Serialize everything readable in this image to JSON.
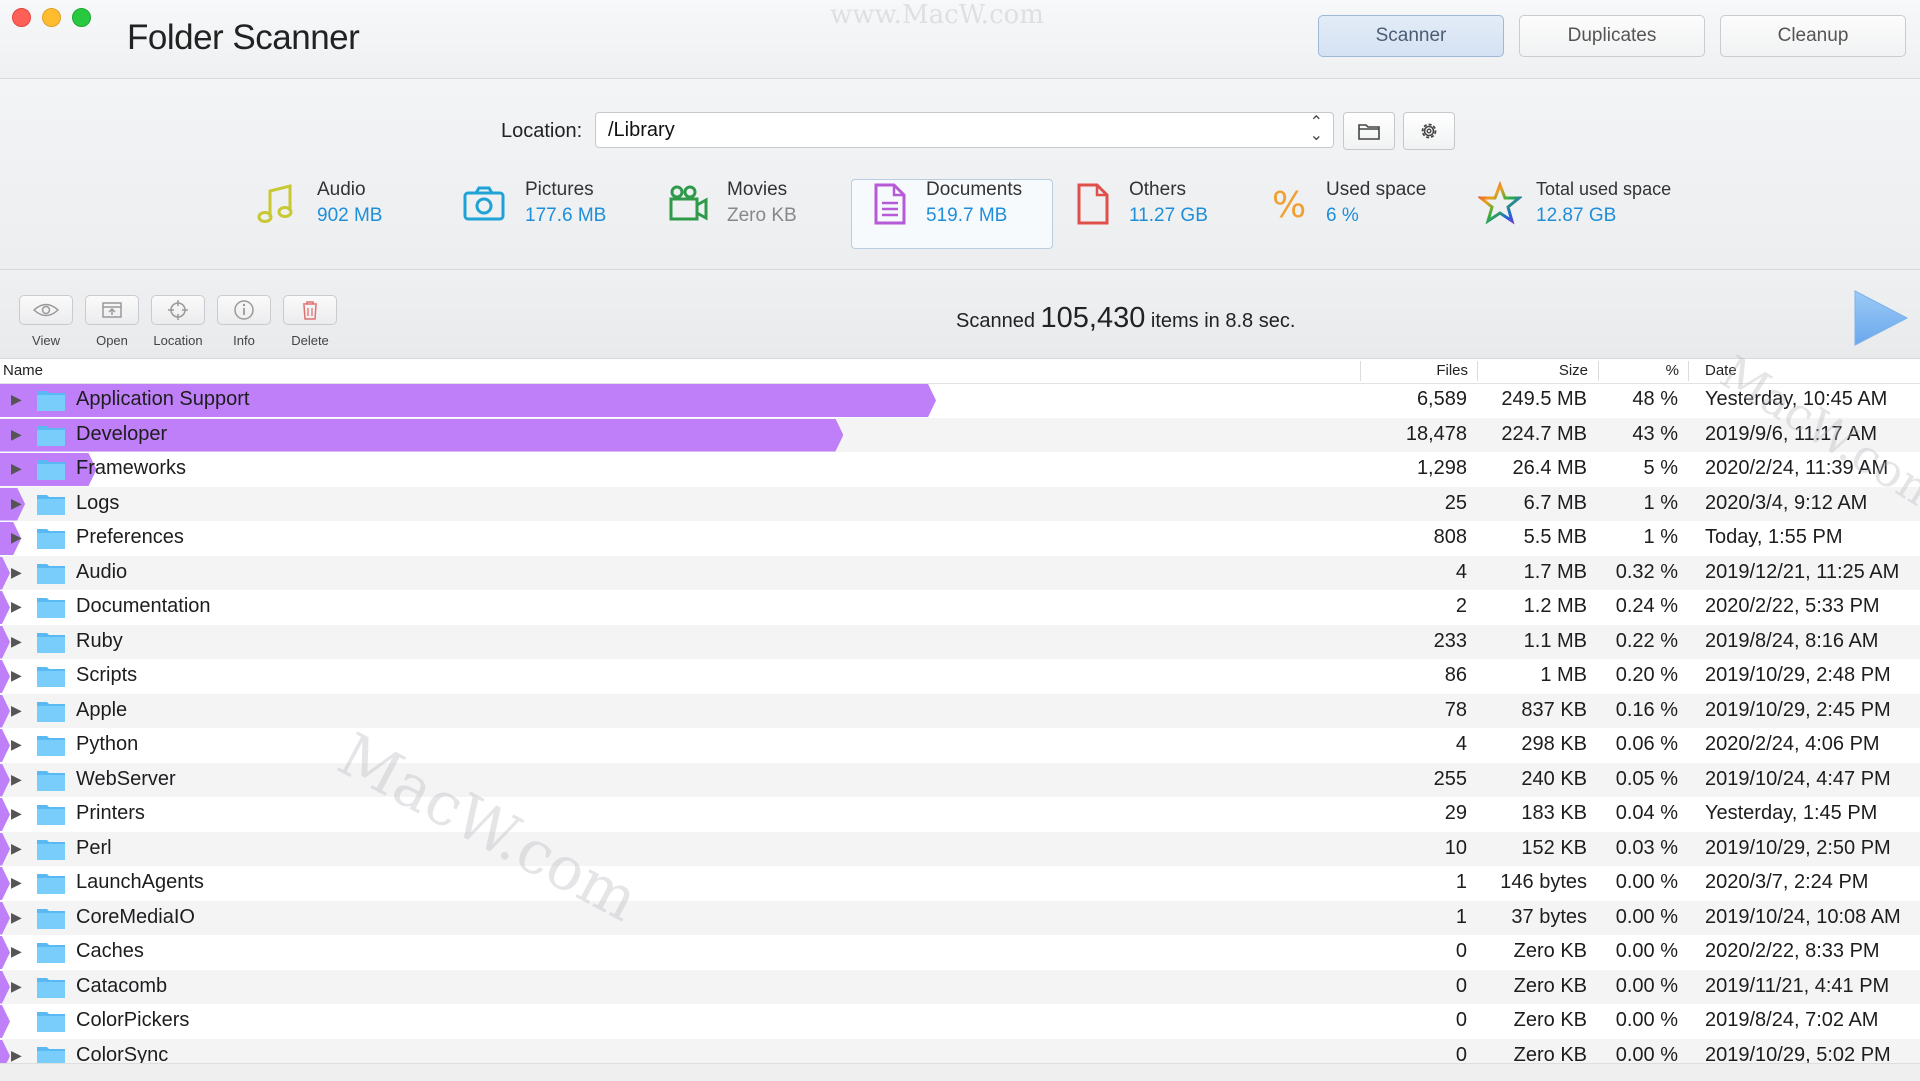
{
  "app": {
    "title": "Folder Scanner"
  },
  "modes": [
    "Scanner",
    "Duplicates",
    "Cleanup"
  ],
  "location": {
    "label": "Location:",
    "value": "/Library"
  },
  "stats": [
    {
      "label": "Audio",
      "value": "902 MB",
      "icon": "music-note-icon",
      "color": "#c8c832"
    },
    {
      "label": "Pictures",
      "value": "177.6 MB",
      "icon": "camera-icon",
      "color": "#1fa3d6"
    },
    {
      "label": "Movies",
      "value": "Zero KB",
      "icon": "video-camera-icon",
      "color": "#2e9a4a"
    },
    {
      "label": "Documents",
      "value": "519.7 MB",
      "icon": "document-icon",
      "color": "#b65ad8"
    },
    {
      "label": "Others",
      "value": "11.27 GB",
      "icon": "file-icon",
      "color": "#e0504a"
    },
    {
      "label": "Used space",
      "value": "6 %",
      "icon": "percent-icon",
      "color": "#f0a030"
    },
    {
      "label": "Total used space",
      "value": "12.87 GB",
      "icon": "star-icon",
      "color": "rainbow"
    }
  ],
  "toolbar": {
    "view": "View",
    "open": "Open",
    "location": "Location",
    "info": "Info",
    "delete": "Delete"
  },
  "scan": {
    "prefix": "Scanned ",
    "count": "105,430",
    "suffix": " items in 8.8 sec."
  },
  "table": {
    "headers": {
      "name": "Name",
      "files": "Files",
      "size": "Size",
      "pct": "%",
      "date": "Date"
    },
    "rows": [
      {
        "name": "Application Support",
        "files": "6,589",
        "size": "249.5 MB",
        "pct": "48 %",
        "date": "Yesterday, 10:45 AM",
        "share": 0.485,
        "expandable": true
      },
      {
        "name": "Developer",
        "files": "18,478",
        "size": "224.7 MB",
        "pct": "43 %",
        "date": "2019/9/6, 11:17 AM",
        "share": 0.437,
        "expandable": true
      },
      {
        "name": "Frameworks",
        "files": "1,298",
        "size": "26.4 MB",
        "pct": "5 %",
        "date": "2020/2/24, 11:39 AM",
        "share": 0.05,
        "expandable": true
      },
      {
        "name": "Logs",
        "files": "25",
        "size": "6.7 MB",
        "pct": "1 %",
        "date": "2020/3/4, 9:12 AM",
        "share": 0.013,
        "expandable": true
      },
      {
        "name": "Preferences",
        "files": "808",
        "size": "5.5 MB",
        "pct": "1 %",
        "date": "Today, 1:55 PM",
        "share": 0.011,
        "expandable": true
      },
      {
        "name": "Audio",
        "files": "4",
        "size": "1.7 MB",
        "pct": "0.32 %",
        "date": "2019/12/21, 11:25 AM",
        "share": 0.0032,
        "expandable": true
      },
      {
        "name": "Documentation",
        "files": "2",
        "size": "1.2 MB",
        "pct": "0.24 %",
        "date": "2020/2/22, 5:33 PM",
        "share": 0.0024,
        "expandable": true
      },
      {
        "name": "Ruby",
        "files": "233",
        "size": "1.1 MB",
        "pct": "0.22 %",
        "date": "2019/8/24, 8:16 AM",
        "share": 0.0022,
        "expandable": true
      },
      {
        "name": "Scripts",
        "files": "86",
        "size": "1 MB",
        "pct": "0.20 %",
        "date": "2019/10/29, 2:48 PM",
        "share": 0.002,
        "expandable": true
      },
      {
        "name": "Apple",
        "files": "78",
        "size": "837 KB",
        "pct": "0.16 %",
        "date": "2019/10/29, 2:45 PM",
        "share": 0.0016,
        "expandable": true
      },
      {
        "name": "Python",
        "files": "4",
        "size": "298 KB",
        "pct": "0.06 %",
        "date": "2020/2/24, 4:06 PM",
        "share": 0.0006,
        "expandable": true
      },
      {
        "name": "WebServer",
        "files": "255",
        "size": "240 KB",
        "pct": "0.05 %",
        "date": "2019/10/24, 4:47 PM",
        "share": 0.0005,
        "expandable": true
      },
      {
        "name": "Printers",
        "files": "29",
        "size": "183 KB",
        "pct": "0.04 %",
        "date": "Yesterday, 1:45 PM",
        "share": 0.0004,
        "expandable": true
      },
      {
        "name": "Perl",
        "files": "10",
        "size": "152 KB",
        "pct": "0.03 %",
        "date": "2019/10/29, 2:50 PM",
        "share": 0.0003,
        "expandable": true
      },
      {
        "name": "LaunchAgents",
        "files": "1",
        "size": "146 bytes",
        "pct": "0.00 %",
        "date": "2020/3/7, 2:24 PM",
        "share": 0,
        "expandable": true
      },
      {
        "name": "CoreMediaIO",
        "files": "1",
        "size": "37 bytes",
        "pct": "0.00 %",
        "date": "2019/10/24, 10:08 AM",
        "share": 0,
        "expandable": true
      },
      {
        "name": "Caches",
        "files": "0",
        "size": "Zero KB",
        "pct": "0.00 %",
        "date": "2020/2/22, 8:33 PM",
        "share": 0,
        "expandable": true
      },
      {
        "name": "Catacomb",
        "files": "0",
        "size": "Zero KB",
        "pct": "0.00 %",
        "date": "2019/11/21, 4:41 PM",
        "share": 0,
        "expandable": true
      },
      {
        "name": "ColorPickers",
        "files": "0",
        "size": "Zero KB",
        "pct": "0.00 %",
        "date": "2019/8/24, 7:02 AM",
        "share": 0,
        "expandable": false
      },
      {
        "name": "ColorSync",
        "files": "0",
        "size": "Zero KB",
        "pct": "0.00 %",
        "date": "2019/10/29, 5:02 PM",
        "share": 0,
        "expandable": true
      }
    ]
  },
  "watermarks": [
    "www.MacW.com",
    "MacW.com",
    "MacW.com"
  ],
  "colors": {
    "bar": "#bf7ff8",
    "accent_blue": "#1e8fd8",
    "folder": "#5ac8fa"
  }
}
